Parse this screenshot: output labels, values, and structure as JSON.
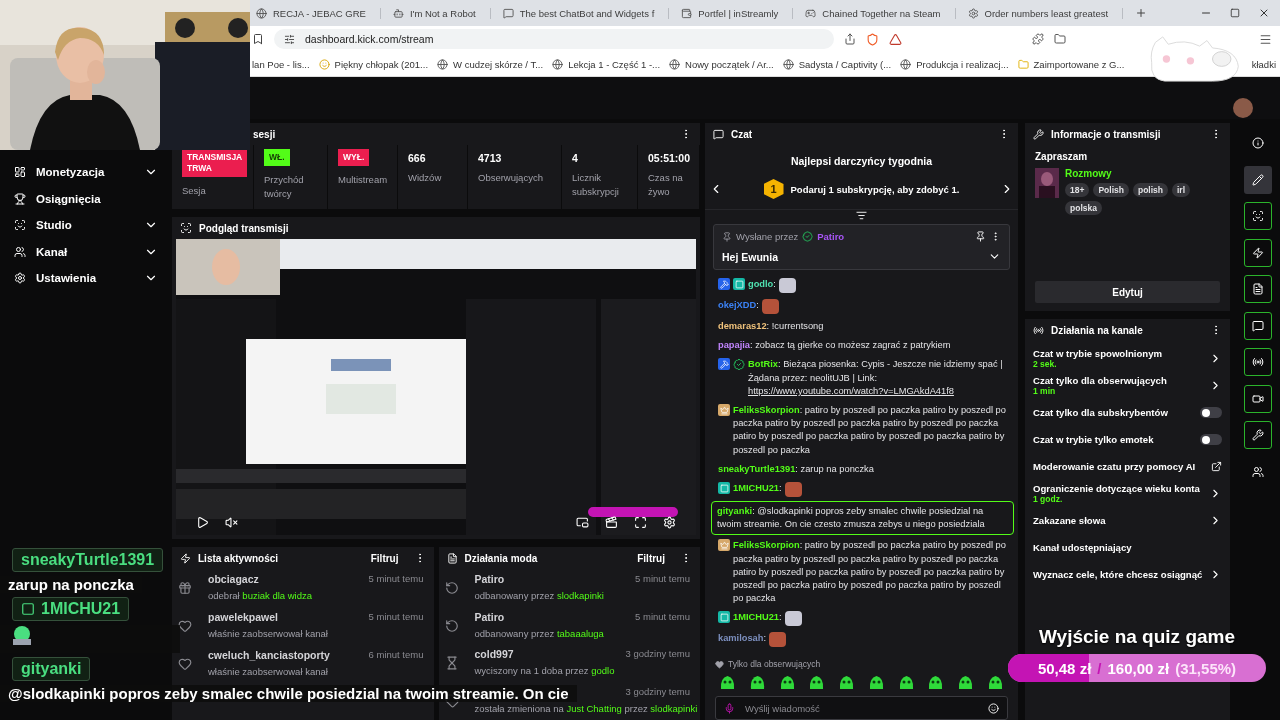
{
  "browser": {
    "tabs": [
      {
        "title": "RECJA - JEBAC GRE",
        "kind": "page"
      },
      {
        "title": "I'm Not a Robot",
        "kind": "robot"
      },
      {
        "title": "The best ChatBot and Widgets f",
        "kind": "bot"
      },
      {
        "title": "Portfel | inStreamly",
        "kind": "wallet"
      },
      {
        "title": "Chained Together na Steam",
        "kind": "steam"
      },
      {
        "title": "Order numbers least greatest",
        "kind": "ai"
      }
    ],
    "address": "dashboard.kick.com/stream",
    "bookmarks": [
      {
        "label": "lan Poe - lis...",
        "kind": "plain"
      },
      {
        "label": "Piękny chłopak (201...",
        "kind": "emoji"
      },
      {
        "label": "W cudzej skórze / T...",
        "kind": "site"
      },
      {
        "label": "Lekcja 1 - Część 1 -...",
        "kind": "site"
      },
      {
        "label": "Nowy początek / Ar...",
        "kind": "site"
      },
      {
        "label": "Sadysta / Captivity (...",
        "kind": "site"
      },
      {
        "label": "Produkcja i realizacj...",
        "kind": "site"
      },
      {
        "label": "Zaimportowane z G...",
        "kind": "folder"
      },
      {
        "label": "kładki",
        "kind": "plain"
      }
    ]
  },
  "sidebar": {
    "items": [
      {
        "label": "Monetyzacja",
        "kind": "chart",
        "expandable": true
      },
      {
        "label": "Osiągnięcia",
        "kind": "trophy",
        "expandable": false
      },
      {
        "label": "Studio",
        "kind": "scan",
        "expandable": true
      },
      {
        "label": "Kanał",
        "kind": "users",
        "expandable": true
      },
      {
        "label": "Ustawienia",
        "kind": "gear",
        "expandable": true
      }
    ]
  },
  "session": {
    "title": "sesji",
    "stats": [
      {
        "kind": "badge",
        "value": "TRANSMISJA TRWA",
        "color": "#eb1e4f",
        "label": "Sesja"
      },
      {
        "kind": "badge",
        "value": "WŁ.",
        "color": "#53fc18",
        "label": "Przychód twórcy"
      },
      {
        "kind": "badge",
        "value": "WYŁ.",
        "color": "#eb1e4f",
        "label": "Multistream"
      },
      {
        "kind": "number",
        "value": "666",
        "label": "Widzów"
      },
      {
        "kind": "number",
        "value": "4713",
        "label": "Obserwujących"
      },
      {
        "kind": "number",
        "value": "4",
        "label": "Licznik subskrypcji"
      },
      {
        "kind": "number",
        "value": "05:51:00",
        "label": "Czas na żywo"
      }
    ]
  },
  "preview": {
    "title": "Podgląd transmisji"
  },
  "activity": {
    "title": "Lista aktywności",
    "filter": "Filtruj",
    "rows": [
      {
        "user": "obciagacz",
        "kind": "gift",
        "detail": [
          {
            "text": "odebrał",
            "highlight": false
          },
          {
            "text": "buziak dla widza",
            "highlight": true
          }
        ],
        "time": "5 minut temu"
      },
      {
        "user": "pawelekpawel",
        "kind": "follow",
        "detail": [
          {
            "text": "właśnie zaobserwował kanał",
            "highlight": false
          }
        ],
        "time": "5 minut temu"
      },
      {
        "user": "cweluch_kanciastoporty",
        "kind": "follow",
        "detail": [
          {
            "text": "właśnie zaobserwował kanał",
            "highlight": false
          }
        ],
        "time": "6 minut temu"
      }
    ]
  },
  "mod_actions": {
    "title": "Działania moda",
    "filter": "Filtruj",
    "rows": [
      {
        "user": "Patiro",
        "kind": "unban",
        "detail": [
          {
            "text": "odbanowany przez",
            "highlight": false
          },
          {
            "text": "slodkapinki",
            "highlight": true
          }
        ],
        "time": "5 minut temu"
      },
      {
        "user": "Patiro",
        "kind": "unban",
        "detail": [
          {
            "text": "odbanowany przez",
            "highlight": false
          },
          {
            "text": "tabaaaluga",
            "highlight": true
          }
        ],
        "time": "5 minut temu"
      },
      {
        "user": "cold997",
        "kind": "mute",
        "detail": [
          {
            "text": "wyciszony na 1 doba przez",
            "highlight": false
          },
          {
            "text": "godlo",
            "highlight": true
          }
        ],
        "time": "3 godziny temu"
      },
      {
        "kind": "category",
        "detail": [
          {
            "text": "została zmieniona na",
            "highlight": false
          },
          {
            "text": "Just Chatting",
            "highlight": true
          },
          {
            "text": "przez",
            "highlight": false
          },
          {
            "text": "slodkapinki",
            "highlight": true
          }
        ],
        "time": "3 godziny temu"
      }
    ]
  },
  "chat": {
    "title": "Czat",
    "donors_title": "Najlepsi darczyńcy tygodnia",
    "donor_rank": "1",
    "donor_text": "Podaruj 1 subskrypcję, aby zdobyć 1.",
    "pinned": {
      "by_label": "Wysłane przez",
      "by_user": "Patiro",
      "text": "Hej Ewunia"
    },
    "separator": ":",
    "messages": [
      {
        "user": "godlo",
        "color": "#4fe0b0",
        "badges": [
          {
            "kind": "mod"
          },
          {
            "kind": "og"
          }
        ],
        "emote": true,
        "highlighted": false
      },
      {
        "user": "okejXDD",
        "color": "#3b82f6",
        "emote": true,
        "highlighted": false
      },
      {
        "user": "demaras12",
        "color": "#f0c27b",
        "text": "!currentsong",
        "emote": false,
        "highlighted": false
      },
      {
        "user": "papajia",
        "color": "#c084fc",
        "text": "zobacz tą gierke co możesz zagrać z patrykiem",
        "emote": false,
        "highlighted": false
      },
      {
        "user": "BotRix",
        "color": "#53fc18",
        "badges": [
          {
            "kind": "mod"
          },
          {
            "kind": "verified"
          }
        ],
        "text": "Bieżąca piosenka: Cypis - Jeszcze nie idziemy spać | Żądana przez: neolitUJB | Link:",
        "link": "https://www.youtube.com/watch?v=LMGAkdA41f8",
        "emote": false,
        "highlighted": false
      },
      {
        "user": "FeliksSkorpion",
        "color": "#53fc18",
        "badges": [
          {
            "kind": "crown"
          }
        ],
        "text": "patiro by poszedl po paczka patiro by poszedl po paczka patiro by poszedl po paczka patiro by poszedl po paczka patiro by poszedl po paczka patiro by poszedl po paczka patiro by poszedl po paczka",
        "emote": false,
        "highlighted": false
      },
      {
        "user": "sneakyTurtle1391",
        "color": "#53fc18",
        "text": "zarup na ponczka",
        "emote": false,
        "highlighted": false
      },
      {
        "user": "1MICHU21",
        "color": "#53fc18",
        "badges": [
          {
            "kind": "og"
          }
        ],
        "emote": true,
        "highlighted": false
      },
      {
        "user": "gityanki",
        "color": "#53fc18",
        "text": "@slodkapinki popros zeby smalec chwile posiedzial na twoim streamie. On cie czesto zmusza zebys u niego posiedziala",
        "emote": false,
        "highlighted": true
      },
      {
        "user": "FeliksSkorpion",
        "color": "#53fc18",
        "badges": [
          {
            "kind": "crown"
          }
        ],
        "text": "patiro by poszedl po paczka patiro by poszedl po paczka patiro by poszedl po paczka patiro by poszedl po paczka patiro by poszedl po paczka patiro by poszedl po paczka patiro by poszedl po paczka patiro by poszedl po paczka patiro by poszedl po paczka",
        "emote": false,
        "highlighted": false
      },
      {
        "user": "1MICHU21",
        "color": "#53fc18",
        "badges": [
          {
            "kind": "og"
          }
        ],
        "emote": true,
        "highlighted": false
      },
      {
        "user": "kamilosah",
        "color": "#7c8fbf",
        "emote": true,
        "highlighted": false
      }
    ],
    "followers_only": "Tylko dla obserwujących",
    "input_placeholder": "Wyślij wiadomość"
  },
  "stream_info": {
    "title": "Informacje o transmisji",
    "stream_title": "Zapraszam",
    "category": "Rozmowy",
    "tags": [
      "18+",
      "Polish",
      "polish",
      "irl",
      "polska"
    ],
    "edit": "Edytuj"
  },
  "channel_actions": {
    "title": "Działania na kanale",
    "items": [
      {
        "label": "Czat w trybie spowolnionym",
        "detail": "2 sek.",
        "kind": "link"
      },
      {
        "label": "Czat tylko dla obserwujących",
        "detail": "1 min",
        "kind": "link"
      },
      {
        "label": "Czat tylko dla subskrybentów",
        "kind": "toggle",
        "on": false
      },
      {
        "label": "Czat w trybie tylko emotek",
        "kind": "toggle",
        "on": false
      },
      {
        "label": "Moderowanie czatu przy pomocy AI",
        "kind": "external"
      },
      {
        "label": "Ograniczenie dotyczące wieku konta",
        "detail": "1 godz.",
        "kind": "link"
      },
      {
        "label": "Zakazane słowa",
        "kind": "link"
      },
      {
        "label": "Kanał udostępniający",
        "kind": "plain"
      },
      {
        "label": "Wyznacz cele, które chcesz osiągnąć",
        "kind": "link"
      }
    ]
  },
  "rail": [
    {
      "kind": "info",
      "selected": false
    },
    {
      "kind": "edit",
      "selected": true
    },
    {
      "kind": "scan",
      "selected": false
    },
    {
      "kind": "bolt",
      "selected": false
    },
    {
      "kind": "notes",
      "selected": false
    },
    {
      "kind": "chat",
      "selected": false
    },
    {
      "kind": "broadcast",
      "selected": false
    },
    {
      "kind": "camera",
      "selected": false
    },
    {
      "kind": "wrench",
      "selected": false
    },
    {
      "kind": "more",
      "selected": false
    }
  ],
  "overlay_chat": [
    {
      "user": "sneakyTurtle1391",
      "badge": false,
      "text": "zarup na ponczka"
    },
    {
      "user": "1MICHU21",
      "badge": true,
      "emote": true
    },
    {
      "user": "gityanki",
      "badge": false,
      "text": "@slodkapinki popros zeby smalec chwile posiedzial na twoim streamie. On cie"
    }
  ],
  "goal": {
    "title": "Wyjście na quiz game",
    "current": "50,48 zł",
    "separator": "/",
    "target": "160,00 zł",
    "percent": "(31,55%)",
    "level": 0.3155
  }
}
